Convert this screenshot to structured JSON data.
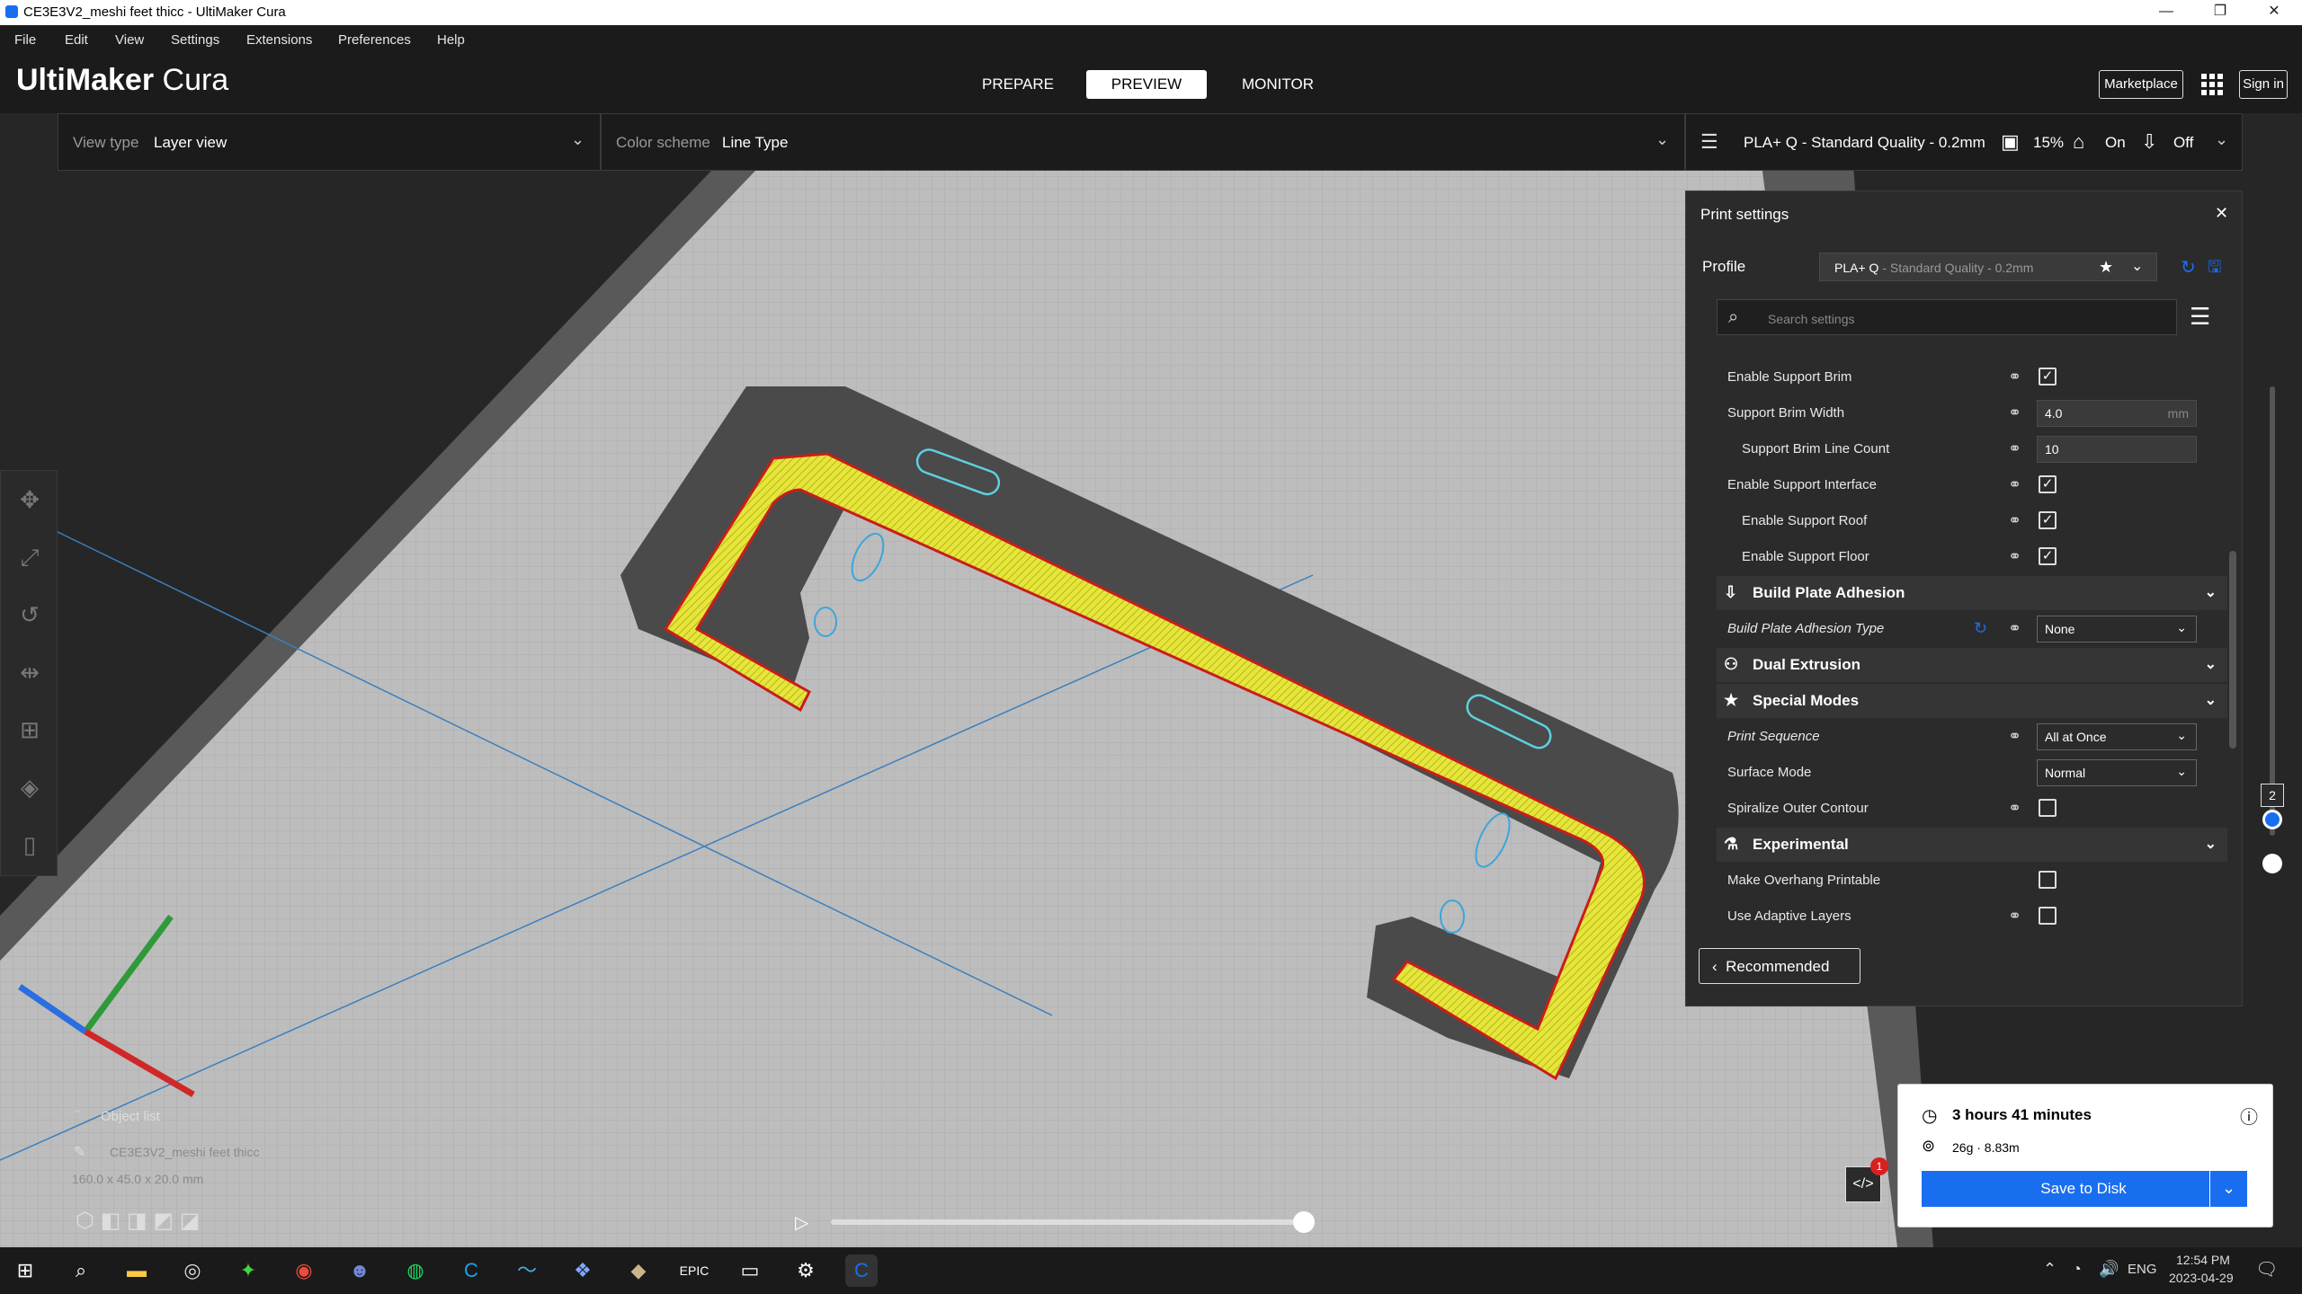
{
  "window": {
    "title": "CE3E3V2_meshi feet thicc - UltiMaker Cura",
    "minimize": "—",
    "maximize": "❐",
    "close": "✕"
  },
  "menu": [
    "File",
    "Edit",
    "View",
    "Settings",
    "Extensions",
    "Preferences",
    "Help"
  ],
  "logo": {
    "brand": "UltiMaker",
    "product": " Cura"
  },
  "stages": [
    {
      "label": "PREPARE"
    },
    {
      "label": "PREVIEW",
      "active": true
    },
    {
      "label": "MONITOR"
    }
  ],
  "header_right": {
    "marketplace": "Marketplace",
    "signin": "Sign in"
  },
  "view_bar": {
    "view_type_label": "View type",
    "view_type_value": "Layer view",
    "color_scheme_label": "Color scheme",
    "color_scheme_value": "Line Type"
  },
  "print_summary": {
    "profile": "PLA+ Q - Standard Quality - 0.2mm",
    "infill": "15%",
    "support": "On",
    "adhesion": "Off"
  },
  "print_settings": {
    "title": "Print settings",
    "profile_label": "Profile",
    "profile_value": "PLA+ Q",
    "profile_suffix": " - Standard Quality - 0.2mm",
    "search_placeholder": "Search settings",
    "rows": [
      {
        "type": "setting",
        "label": "Enable Support Brim",
        "control": "check",
        "checked": true,
        "link": true
      },
      {
        "type": "setting",
        "label": "Support Brim Width",
        "control": "field",
        "value": "4.0",
        "unit": "mm",
        "link": true
      },
      {
        "type": "setting",
        "label": "Support Brim Line Count",
        "control": "field",
        "value": "10",
        "indent": true,
        "link": true
      },
      {
        "type": "setting",
        "label": "Enable Support Interface",
        "control": "check",
        "checked": true,
        "link": true
      },
      {
        "type": "setting",
        "label": "Enable Support Roof",
        "control": "check",
        "checked": true,
        "indent": true,
        "link": true
      },
      {
        "type": "setting",
        "label": "Enable Support Floor",
        "control": "check",
        "checked": true,
        "indent": true,
        "link": true
      },
      {
        "type": "category",
        "label": "Build Plate Adhesion",
        "icon": "⇩"
      },
      {
        "type": "setting",
        "label": "Build Plate Adhesion Type",
        "control": "drop",
        "value": "None",
        "italic": true,
        "link": true,
        "reset": true
      },
      {
        "type": "category",
        "label": "Dual Extrusion",
        "icon": "⚇"
      },
      {
        "type": "category",
        "label": "Special Modes",
        "icon": "★"
      },
      {
        "type": "setting",
        "label": "Print Sequence",
        "control": "drop",
        "value": "All at Once",
        "italic": true,
        "link": true
      },
      {
        "type": "setting",
        "label": "Surface Mode",
        "control": "drop",
        "value": "Normal"
      },
      {
        "type": "setting",
        "label": "Spiralize Outer Contour",
        "control": "check",
        "checked": false,
        "link": true
      },
      {
        "type": "category",
        "label": "Experimental",
        "icon": "⚗"
      },
      {
        "type": "setting",
        "label": "Make Overhang Printable",
        "control": "check",
        "checked": false
      },
      {
        "type": "setting",
        "label": "Use Adaptive Layers",
        "control": "check",
        "checked": false,
        "link": true
      }
    ],
    "recommended_label": "Recommended"
  },
  "object_list": {
    "header": "Object list",
    "name": "CE3E3V2_meshi feet thicc",
    "dims": "160.0 x 45.0 x 20.0 mm"
  },
  "layer_slider": {
    "current": "2",
    "level": 0.02
  },
  "playback": {
    "progress": 1.0
  },
  "print_card": {
    "time": "3 hours 41 minutes",
    "material": "26g · 8.83m",
    "save_label": "Save to Disk"
  },
  "notification": {
    "badge": "1"
  },
  "tray": {
    "lang": "ENG",
    "time": "12:54 PM",
    "date": "2023-04-29"
  },
  "colors": {
    "accent": "#196ef0",
    "wall": "#c91c1c",
    "infill": "#e6e63a",
    "skin": "#ffff00",
    "support": "#5dd0e0"
  }
}
